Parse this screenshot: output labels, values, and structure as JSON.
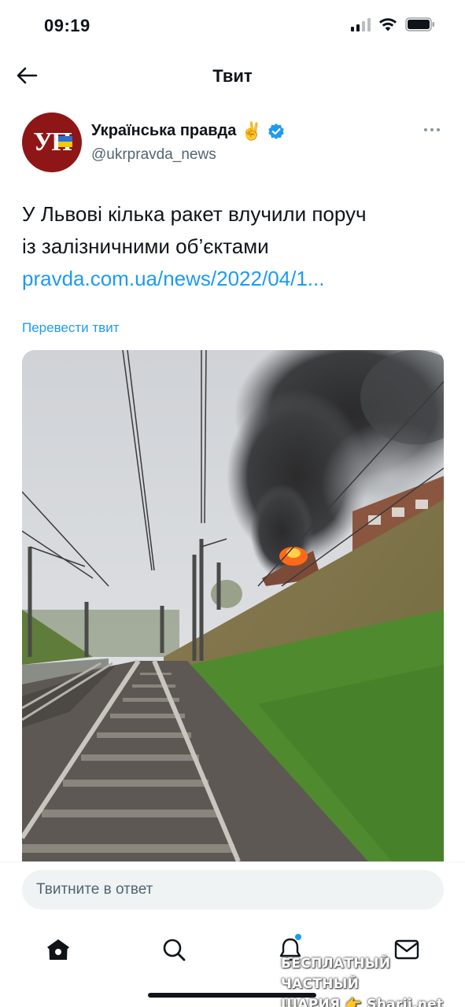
{
  "status_bar": {
    "time": "09:19",
    "icons": [
      "cellular-signal-icon",
      "wifi-icon",
      "battery-icon"
    ]
  },
  "header": {
    "title": "Твит",
    "back_icon": "arrow-left-icon"
  },
  "tweet": {
    "author": {
      "avatar_text": "УП",
      "name": "Українська правда",
      "emoji": "✌️",
      "verified": true,
      "handle": "@ukrpravda_news"
    },
    "text_line1": "У Львові кілька ракет влучили поруч",
    "text_line2": "із залізничними об’єктами",
    "link": "pravda.com.ua/news/2022/04/1...",
    "translate_label": "Перевести твит"
  },
  "reply": {
    "placeholder": "Твитните в ответ"
  },
  "tab_bar": {
    "tabs": [
      "home-icon",
      "search-icon",
      "notifications-icon",
      "messages-icon"
    ]
  },
  "watermark": {
    "line1": "БЕСПЛАТНЫЙ ЧАСТНЫЙ",
    "line2": "ШАРИЯ 👉 Sharij.net"
  },
  "colors": {
    "accent": "#1d9bf0",
    "text": "#0f1419",
    "secondary_text": "#536471",
    "avatar_bg": "#8f1616",
    "input_bg": "#eff3f4"
  }
}
